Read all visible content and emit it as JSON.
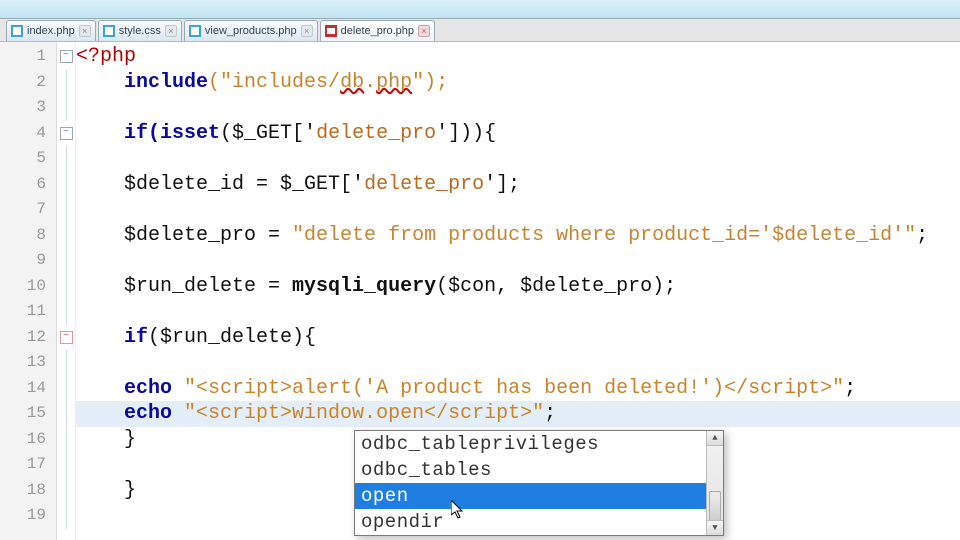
{
  "tabs": [
    {
      "label": "index.php",
      "active": false,
      "type": "css"
    },
    {
      "label": "style.css",
      "active": false,
      "type": "css"
    },
    {
      "label": "view_products.php",
      "active": false,
      "type": "css"
    },
    {
      "label": "delete_pro.php",
      "active": true,
      "type": "php"
    }
  ],
  "lines": {
    "l1_open": "<?php",
    "l2_kw": "include",
    "l2_str": "(\"includes/",
    "l2_sq": "db",
    "l2_dot": ".",
    "l2_php": "php",
    "l2_end": "\");",
    "l4_if": "if(",
    "l4_isset": "isset",
    "l4_rest": "($_GET['",
    "l4_key": "delete_pro",
    "l4_close": "'])){",
    "l6": "$delete_id = $_GET['",
    "l6_key": "delete_pro",
    "l6_end": "'];",
    "l8": "$delete_pro = ",
    "l8_str": "\"delete from products where product_id='$delete_id'\"",
    "l8_end": ";",
    "l10": "$run_delete = ",
    "l10_fn": "mysqli_query",
    "l10_args": "($con, $delete_pro);",
    "l12_if": "if",
    "l12_rest": "($run_delete){",
    "l14_echo": "echo ",
    "l14_str": "\"<script>alert('A product has been deleted!')</script>\"",
    "l14_end": ";",
    "l15_echo": "echo ",
    "l15_str": "\"<script>window.open</script>\"",
    "l15_end": ";",
    "l16": "}",
    "l18": "}"
  },
  "autocomplete": {
    "options": [
      "odbc_tableprivileges",
      "odbc_tables",
      "open",
      "opendir"
    ],
    "selected": "open"
  }
}
